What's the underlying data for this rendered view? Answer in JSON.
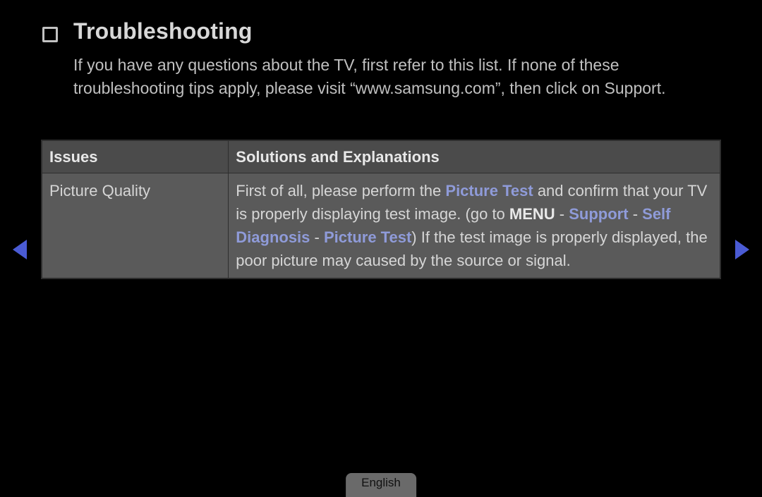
{
  "heading": {
    "title": "Troubleshooting"
  },
  "intro": {
    "text": "If you have any questions about the TV, first refer to this list. If none of these troubleshooting tips apply, please visit “www.samsung.com”, then click on Support."
  },
  "table": {
    "headers": {
      "issues": "Issues",
      "solutions": "Solutions and Explanations"
    },
    "rows": [
      {
        "issue": "Picture Quality",
        "solution": {
          "s1": "First of all, please perform the ",
          "h1": "Picture Test",
          "s2": " and confirm that your TV is properly displaying test image. (go to ",
          "b1": "MENU",
          "s3": " - ",
          "h2": "Support",
          "s4": " - ",
          "h3": "Self Diagnosis",
          "s5": " - ",
          "h4": "Picture Test",
          "s6": ") If the test image is properly displayed, the poor picture may caused by the source or signal."
        }
      }
    ]
  },
  "footer": {
    "language": "English"
  }
}
